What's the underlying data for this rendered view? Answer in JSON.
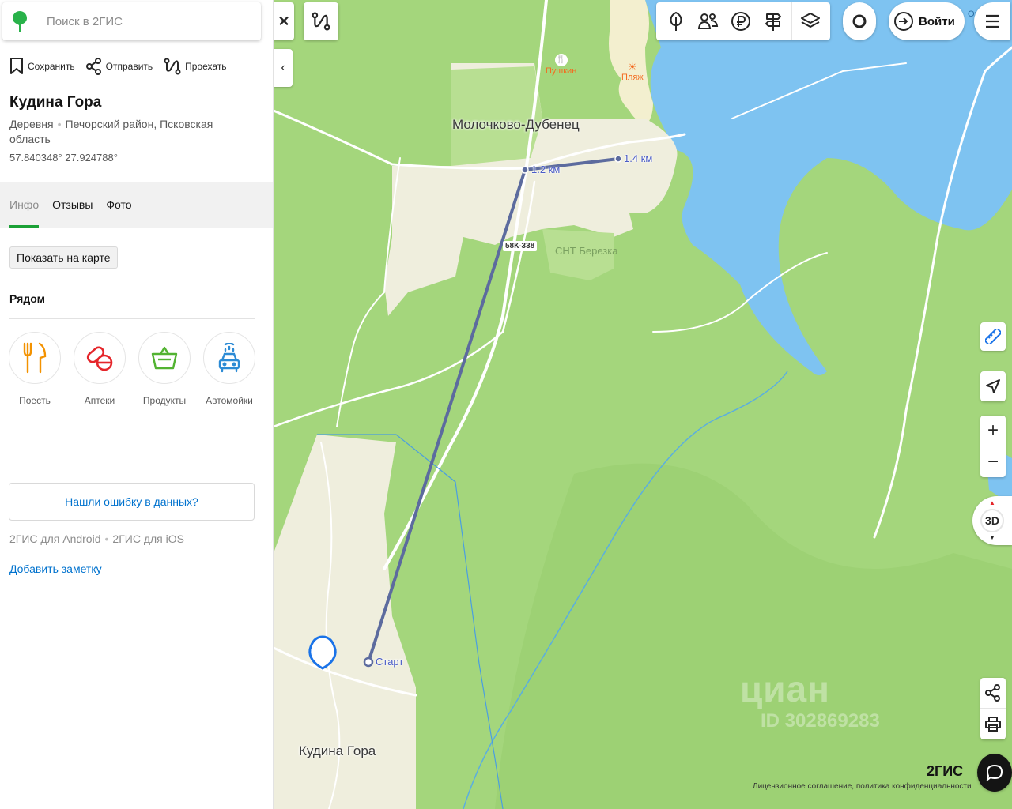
{
  "search": {
    "placeholder": "Поиск в 2ГИС"
  },
  "actions": {
    "save": "Сохранить",
    "send": "Отправить",
    "route": "Проехать"
  },
  "place": {
    "name": "Кудина Гора",
    "type": "Деревня",
    "address": "Печорский район, Псковская область",
    "coordinates": "57.840348° 27.924788°"
  },
  "tabs": [
    {
      "label": "Инфо",
      "active": true
    },
    {
      "label": "Отзывы",
      "active": false
    },
    {
      "label": "Фото",
      "active": false
    }
  ],
  "show_on_map": "Показать на карте",
  "nearby": {
    "title": "Рядом",
    "items": [
      {
        "label": "Поесть",
        "icon": "fork-knife-icon",
        "color": "#f39200"
      },
      {
        "label": "Аптеки",
        "icon": "pills-icon",
        "color": "#e5252a"
      },
      {
        "label": "Продукты",
        "icon": "basket-icon",
        "color": "#52b331"
      },
      {
        "label": "Автомойки",
        "icon": "car-wash-icon",
        "color": "#2c8bd5"
      }
    ]
  },
  "report_error": "Нашли ошибку в данных?",
  "apps": {
    "android": "2ГИС для Android",
    "ios": "2ГИС для iOS"
  },
  "add_note": "Добавить заметку",
  "map": {
    "login": "Войти",
    "mode_3d": "3D",
    "labels": {
      "village_top": "Молочково-Дубенец",
      "village_bottom": "Кудина Гора",
      "snt": "СНТ Березка",
      "road": "58К-338",
      "cafe": "Пушкин",
      "beach": "Пляж",
      "lake_partial": "Оз"
    },
    "measure": {
      "start": "Старт",
      "mid": "1.2 км",
      "end": "1.4 км"
    },
    "brand": "2ГИС",
    "footer": "Лицензионное соглашение, политика конфиденциальности",
    "watermark": {
      "name": "циан",
      "id": "ID 302869283"
    },
    "colors": {
      "forest": "#a4d67c",
      "settlement": "#efeedd",
      "water": "#7ec3f1",
      "route": "#5c6b9e"
    }
  }
}
